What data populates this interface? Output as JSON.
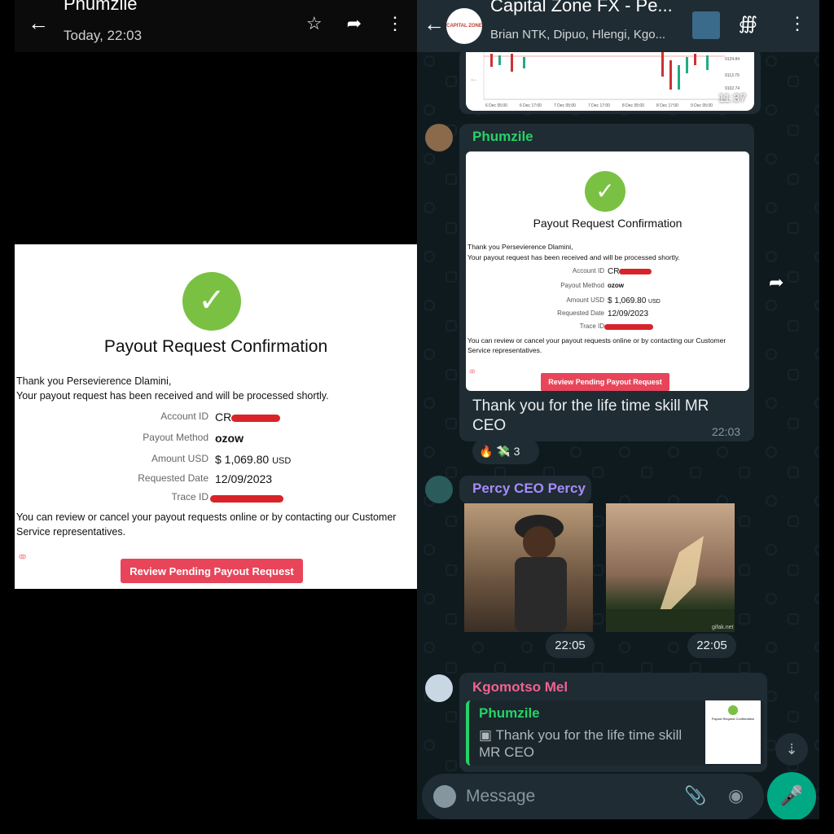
{
  "left": {
    "header": {
      "title": "Phumzile",
      "subtitle": "Today, 22:03"
    },
    "card": {
      "title": "Payout Request Confirmation",
      "line1": "Thank you Persevierence Dlamini,",
      "line2": "Your payout request has been received and will be processed shortly.",
      "rows": [
        {
          "key": "Account ID",
          "value": "CR"
        },
        {
          "key": "Payout Method",
          "value": "ozow"
        },
        {
          "key": "Amount USD",
          "value": "$ 1,069.80",
          "unit": "USD"
        },
        {
          "key": "Requested Date",
          "value": "12/09/2023"
        },
        {
          "key": "Trace ID",
          "value": ""
        }
      ],
      "footer": "You can review or cancel your payout requests online or by contacting our Customer Service representatives.",
      "button": "Review Pending Payout Request"
    }
  },
  "chat": {
    "header": {
      "title": "Capital Zone FX - Pe...",
      "subtitle": "Brian NTK, Dipuo, Hlengi, Kgo...",
      "avatar_text": "CAPITAL ZONE"
    },
    "trading_image": {
      "time": "11:37",
      "price_labels": [
        "9124.84",
        "9113.79",
        "9102.74"
      ],
      "date_labels": [
        "6 Dec 05:00",
        "6 Dec 17:00",
        "7 Dec 05:00",
        "7 Dec 17:00",
        "8 Dec 05:00",
        "8 Dec 17:00",
        "9 Dec 05:00"
      ]
    },
    "msg1": {
      "sender": "Phumzile",
      "sender_color": "#25d366",
      "text": "Thank you for the life time skill MR CEO",
      "time": "22:03",
      "reaction_count": "3"
    },
    "msg2": {
      "sender": "Percy CEO Percy",
      "sender_color": "#a78bfa",
      "time1": "22:05",
      "time2": "22:05",
      "watermark": "gifak.net"
    },
    "msg3": {
      "sender": "Kgomotso Mel",
      "sender_color": "#f06292",
      "quote_name": "Phumzile",
      "quote_text": "Thank you for the life time skill MR CEO"
    },
    "composer": {
      "placeholder": "Message"
    }
  }
}
